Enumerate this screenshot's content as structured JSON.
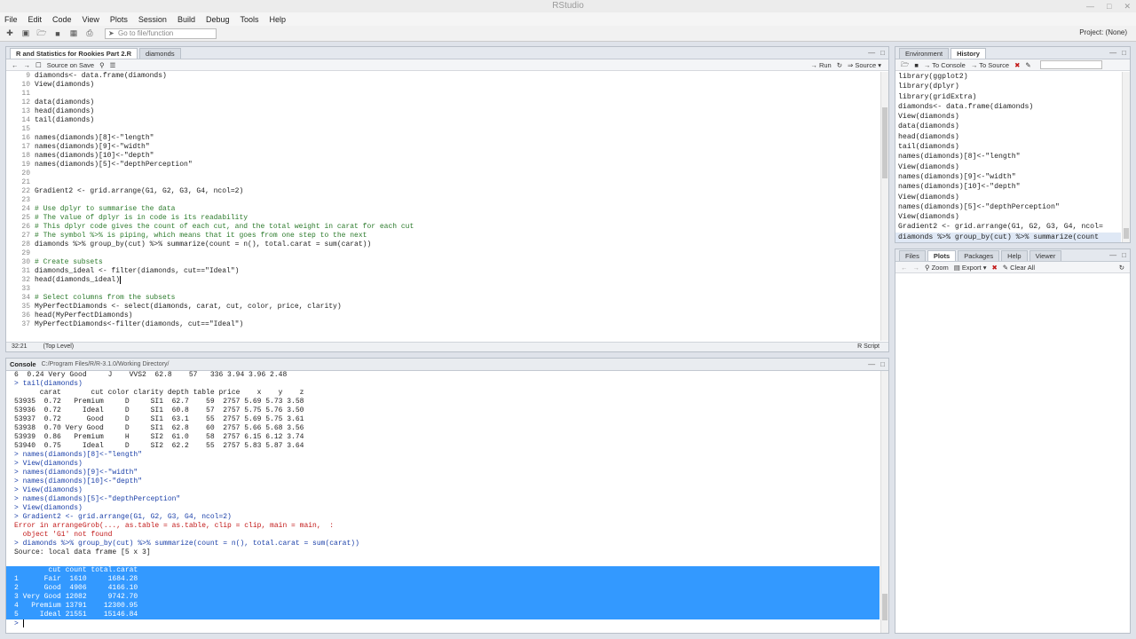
{
  "app": {
    "title": "RStudio"
  },
  "menu": [
    "File",
    "Edit",
    "Code",
    "View",
    "Plots",
    "Session",
    "Build",
    "Debug",
    "Tools",
    "Help"
  ],
  "toolbar": {
    "goto_placeholder": "Go to file/function",
    "project": "Project: (None)"
  },
  "source": {
    "tabs": [
      "R and Statistics for Rookies Part 2.R",
      "diamonds"
    ],
    "source_on_save": "Source on Save",
    "run": "Run",
    "source_btn": "Source",
    "lines": [
      {
        "n": "9",
        "t": "diamonds<- data.frame(diamonds)",
        "c": false
      },
      {
        "n": "10",
        "t": "View(diamonds)",
        "c": false
      },
      {
        "n": "11",
        "t": "",
        "c": false
      },
      {
        "n": "12",
        "t": "data(diamonds)",
        "c": false
      },
      {
        "n": "13",
        "t": "head(diamonds)",
        "c": false
      },
      {
        "n": "14",
        "t": "tail(diamonds)",
        "c": false
      },
      {
        "n": "15",
        "t": "",
        "c": false
      },
      {
        "n": "16",
        "t": "names(diamonds)[8]<-\"length\"",
        "c": false
      },
      {
        "n": "17",
        "t": "names(diamonds)[9]<-\"width\"",
        "c": false
      },
      {
        "n": "18",
        "t": "names(diamonds)[10]<-\"depth\"",
        "c": false
      },
      {
        "n": "19",
        "t": "names(diamonds)[5]<-\"depthPerception\"",
        "c": false
      },
      {
        "n": "20",
        "t": "",
        "c": false
      },
      {
        "n": "21",
        "t": "",
        "c": false
      },
      {
        "n": "22",
        "t": "Gradient2 <- grid.arrange(G1, G2, G3, G4, ncol=2)",
        "c": false
      },
      {
        "n": "23",
        "t": "",
        "c": false
      },
      {
        "n": "24",
        "t": "# Use dplyr to summarise the data",
        "c": true
      },
      {
        "n": "25",
        "t": "# The value of dplyr is in code is its readability",
        "c": true
      },
      {
        "n": "26",
        "t": "# This dplyr code gives the count of each cut, and the total weight in carat for each cut",
        "c": true
      },
      {
        "n": "27",
        "t": "# The symbol %>% is piping, which means that it goes from one step to the next",
        "c": true
      },
      {
        "n": "28",
        "t": "diamonds %>% group_by(cut) %>% summarize(count = n(), total.carat = sum(carat))",
        "c": false
      },
      {
        "n": "29",
        "t": "",
        "c": false
      },
      {
        "n": "30",
        "t": "# Create subsets",
        "c": true
      },
      {
        "n": "31",
        "t": "diamonds_ideal <- filter(diamonds, cut==\"Ideal\")",
        "c": false
      },
      {
        "n": "32",
        "t": "head(diamonds_ideal)",
        "c": false
      },
      {
        "n": "33",
        "t": "",
        "c": false
      },
      {
        "n": "34",
        "t": "# Select columns from the subsets",
        "c": true
      },
      {
        "n": "35",
        "t": "MyPerfectDiamonds <- select(diamonds, carat, cut, color, price, clarity)",
        "c": false
      },
      {
        "n": "36",
        "t": "head(MyPerfectDiamonds)",
        "c": false
      },
      {
        "n": "37",
        "t": "MyPerfectDiamonds<-filter(diamonds, cut==\"Ideal\")",
        "c": false
      }
    ],
    "status_pos": "32:21",
    "status_level": "(Top Level)",
    "status_type": "R Script"
  },
  "console": {
    "title": "Console",
    "path": "C:/Program Files/R/R-3.1.0/Working Directory/",
    "lines": [
      {
        "t": "6  0.24 Very Good     J    VVS2  62.8    57   336 3.94 3.96 2.48",
        "k": ""
      },
      {
        "t": "> tail(diamonds)",
        "k": "cmd"
      },
      {
        "t": "      carat       cut color clarity depth table price    x    y    z",
        "k": ""
      },
      {
        "t": "53935  0.72   Premium     D     SI1  62.7    59  2757 5.69 5.73 3.58",
        "k": ""
      },
      {
        "t": "53936  0.72     Ideal     D     SI1  60.8    57  2757 5.75 5.76 3.50",
        "k": ""
      },
      {
        "t": "53937  0.72      Good     D     SI1  63.1    55  2757 5.69 5.75 3.61",
        "k": ""
      },
      {
        "t": "53938  0.70 Very Good     D     SI1  62.8    60  2757 5.66 5.68 3.56",
        "k": ""
      },
      {
        "t": "53939  0.86   Premium     H     SI2  61.0    58  2757 6.15 6.12 3.74",
        "k": ""
      },
      {
        "t": "53940  0.75     Ideal     D     SI2  62.2    55  2757 5.83 5.87 3.64",
        "k": ""
      },
      {
        "t": "> names(diamonds)[8]<-\"length\"",
        "k": "cmd"
      },
      {
        "t": "> View(diamonds)",
        "k": "cmd"
      },
      {
        "t": "> names(diamonds)[9]<-\"width\"",
        "k": "cmd"
      },
      {
        "t": "> names(diamonds)[10]<-\"depth\"",
        "k": "cmd"
      },
      {
        "t": "> View(diamonds)",
        "k": "cmd"
      },
      {
        "t": "> names(diamonds)[5]<-\"depthPerception\"",
        "k": "cmd"
      },
      {
        "t": "> View(diamonds)",
        "k": "cmd"
      },
      {
        "t": "> Gradient2 <- grid.arrange(G1, G2, G3, G4, ncol=2)",
        "k": "cmd"
      },
      {
        "t": "Error in arrangeGrob(..., as.table = as.table, clip = clip, main = main,  :",
        "k": "err"
      },
      {
        "t": "  object 'G1' not found",
        "k": "err"
      },
      {
        "t": "> diamonds %>% group_by(cut) %>% summarize(count = n(), total.carat = sum(carat))",
        "k": "cmd"
      },
      {
        "t": "Source: local data frame [5 x 3]",
        "k": ""
      },
      {
        "t": "",
        "k": ""
      },
      {
        "t": "        cut count total.carat",
        "k": "sel"
      },
      {
        "t": "1      Fair  1610     1684.28",
        "k": "sel"
      },
      {
        "t": "2      Good  4906     4166.10",
        "k": "sel"
      },
      {
        "t": "3 Very Good 12082     9742.70",
        "k": "sel"
      },
      {
        "t": "4   Premium 13791    12300.95",
        "k": "sel"
      },
      {
        "t": "5     Ideal 21551    15146.84",
        "k": "sel"
      },
      {
        "t": "> ",
        "k": "cmd"
      }
    ]
  },
  "env": {
    "tabs": [
      "Environment",
      "History"
    ],
    "to_console": "To Console",
    "to_source": "To Source",
    "history": [
      "library(ggplot2)",
      "library(dplyr)",
      "library(gridExtra)",
      "diamonds<- data.frame(diamonds)",
      "View(diamonds)",
      "data(diamonds)",
      "head(diamonds)",
      "tail(diamonds)",
      "names(diamonds)[8]<-\"length\"",
      "View(diamonds)",
      "names(diamonds)[9]<-\"width\"",
      "names(diamonds)[10]<-\"depth\"",
      "View(diamonds)",
      "names(diamonds)[5]<-\"depthPerception\"",
      "View(diamonds)",
      "Gradient2 <- grid.arrange(G1, G2, G3, G4, ncol=",
      "diamonds %>% group_by(cut) %>% summarize(count"
    ]
  },
  "files": {
    "tabs": [
      "Files",
      "Plots",
      "Packages",
      "Help",
      "Viewer"
    ],
    "zoom": "Zoom",
    "export": "Export",
    "clear_all": "Clear All"
  }
}
